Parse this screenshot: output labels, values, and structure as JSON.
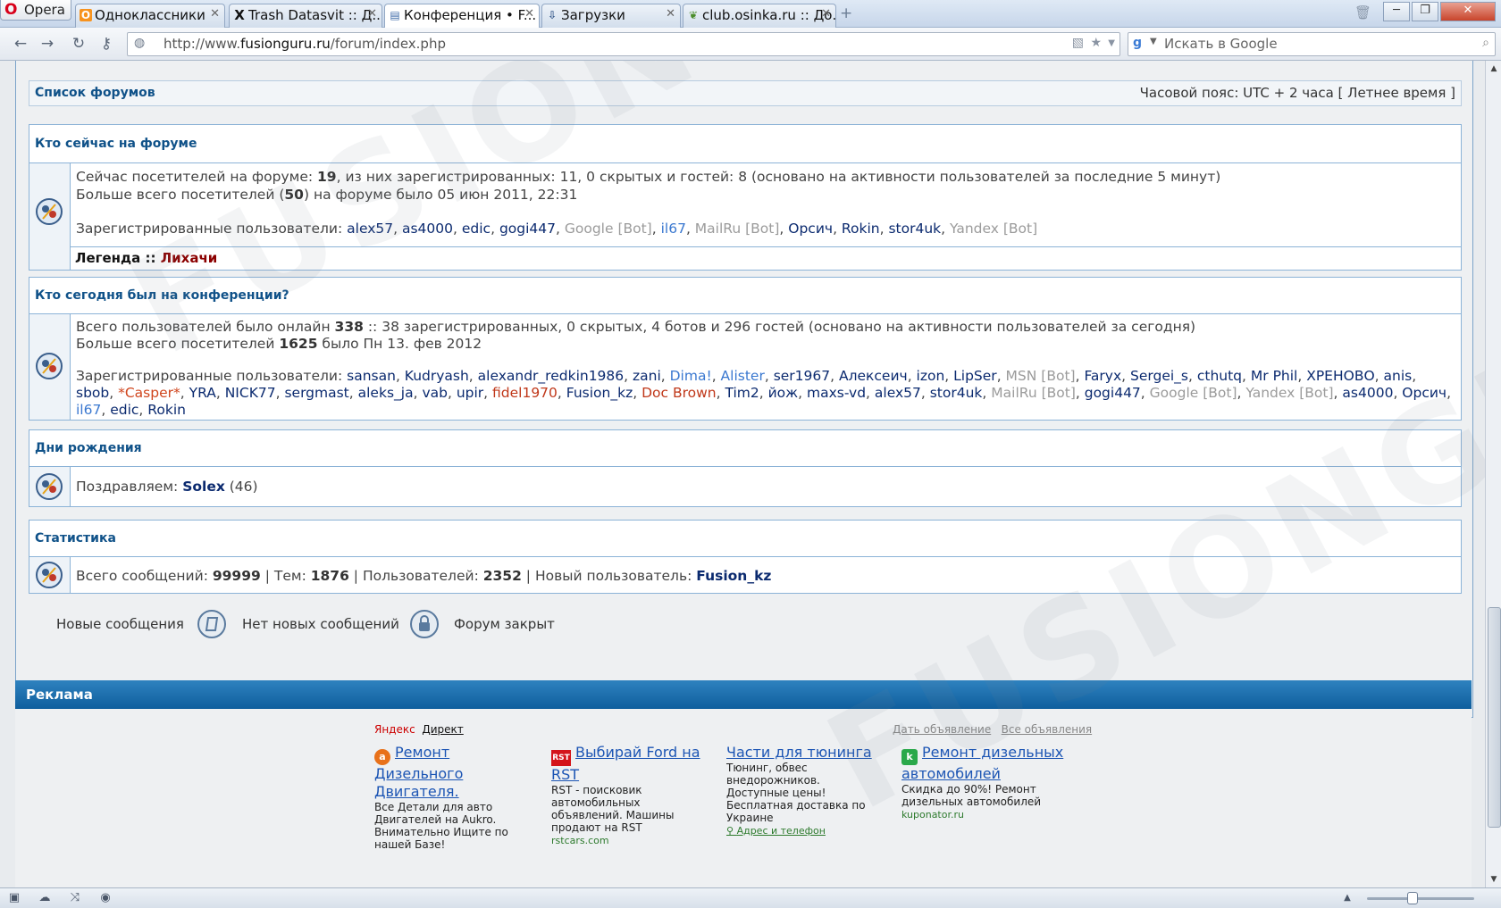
{
  "browser": {
    "menu_label": "Opera",
    "tabs": [
      {
        "label": "Одноклассники",
        "favicon": "ok-icon",
        "glyph": "О",
        "color": "#f7931e"
      },
      {
        "label": "Trash Datasvit :: Д...",
        "favicon": "x-icon",
        "glyph": "X",
        "color": "#111111"
      },
      {
        "label": "Конференция • F...",
        "favicon": "forum-icon",
        "glyph": "▤",
        "color": "#3c6aa8",
        "active": true
      },
      {
        "label": "Загрузки",
        "favicon": "download-icon",
        "glyph": "⇩",
        "color": "#3d5f8f"
      },
      {
        "label": "club.osinka.ru :: До...",
        "favicon": "leaf-icon",
        "glyph": "❦",
        "color": "#4a8d2a"
      }
    ],
    "url_prefix": "http://www.",
    "url_domain": "fusionguru.ru",
    "url_path": "/forum/index.php",
    "search_placeholder": "Искать в Google"
  },
  "forum": {
    "nav": {
      "index_link": "Список форумов",
      "timezone": "Часовой пояс: UTC + 2 часа [ Летнее время ]"
    },
    "online": {
      "title": "Кто сейчас на форуме",
      "l1_pre": "Сейчас посетителей на форуме: ",
      "l1_total": "19",
      "l1_post": ", из них зарегистрированных: 11, 0 скрытых и гостей: 8 (основано на активности пользователей за последние 5 минут)",
      "l2_pre": "Больше всего посетителей (",
      "l2_max": "50",
      "l2_post": ") на форуме было 05 июн 2011, 22:31",
      "reg_label": "Зарегистрированные пользователи: ",
      "users": [
        {
          "name": "alex57",
          "c": "u"
        },
        {
          "name": "as4000",
          "c": "u"
        },
        {
          "name": "edic",
          "c": "u"
        },
        {
          "name": "gogi447",
          "c": "u"
        },
        {
          "name": "Google [Bot]",
          "c": "ug"
        },
        {
          "name": "il67",
          "c": "ub"
        },
        {
          "name": "MailRu [Bot]",
          "c": "ug"
        },
        {
          "name": "Орсич",
          "c": "u"
        },
        {
          "name": "Rokin",
          "c": "u"
        },
        {
          "name": "stor4uk",
          "c": "u"
        },
        {
          "name": "Yandex [Bot]",
          "c": "ug"
        }
      ],
      "legend_label": "Легенда :: ",
      "legend_group": "Лихачи"
    },
    "today": {
      "title": "Кто сегодня был на конференции?",
      "l1_pre": "Всего пользователей было онлайн ",
      "l1_total": "338",
      "l1_post": " :: 38 зарегистрированных, 0 скрытых, 4 ботов и 296 гостей (основано на активности пользователей за сегодня)",
      "l2_pre": "Больше всего посетителей ",
      "l2_max": "1625",
      "l2_post": " было Пн 13. фев 2012",
      "reg_label": "Зарегистрированные пользователи: ",
      "users": [
        {
          "name": "sansan",
          "c": "u"
        },
        {
          "name": "Kudryash",
          "c": "u"
        },
        {
          "name": "alexandr_redkin1986",
          "c": "u"
        },
        {
          "name": "zani",
          "c": "u"
        },
        {
          "name": "Dima!",
          "c": "ub"
        },
        {
          "name": "Alister",
          "c": "ub"
        },
        {
          "name": "ser1967",
          "c": "u"
        },
        {
          "name": "Алексеич",
          "c": "u"
        },
        {
          "name": "izon",
          "c": "u"
        },
        {
          "name": "LipSer",
          "c": "u"
        },
        {
          "name": "MSN [Bot]",
          "c": "ug"
        },
        {
          "name": "Faryx",
          "c": "u"
        },
        {
          "name": "Sergei_s",
          "c": "u"
        },
        {
          "name": "cthutq",
          "c": "u"
        },
        {
          "name": "Mr Phil",
          "c": "u"
        },
        {
          "name": "ХРЕНОВО",
          "c": "u"
        },
        {
          "name": "anis",
          "c": "u"
        },
        {
          "name": "sbob",
          "c": "u"
        },
        {
          "name": "*Casper*",
          "c": "ur"
        },
        {
          "name": "YRA",
          "c": "u"
        },
        {
          "name": "NICK77",
          "c": "u"
        },
        {
          "name": "sergmast",
          "c": "u"
        },
        {
          "name": "aleks_ja",
          "c": "u"
        },
        {
          "name": "vab",
          "c": "u"
        },
        {
          "name": "upir",
          "c": "u"
        },
        {
          "name": "fidel1970",
          "c": "urd"
        },
        {
          "name": "Fusion_kz",
          "c": "u"
        },
        {
          "name": "Doc Brown",
          "c": "urd"
        },
        {
          "name": "Tim2",
          "c": "u"
        },
        {
          "name": "йож",
          "c": "u"
        },
        {
          "name": "maxs-vd",
          "c": "u"
        },
        {
          "name": "alex57",
          "c": "u"
        },
        {
          "name": "stor4uk",
          "c": "u"
        },
        {
          "name": "MailRu [Bot]",
          "c": "ug"
        },
        {
          "name": "gogi447",
          "c": "u"
        },
        {
          "name": "Google [Bot]",
          "c": "ug"
        },
        {
          "name": "Yandex [Bot]",
          "c": "ug"
        },
        {
          "name": "as4000",
          "c": "u"
        },
        {
          "name": "Орсич",
          "c": "u"
        },
        {
          "name": "il67",
          "c": "ub"
        },
        {
          "name": "edic",
          "c": "u"
        },
        {
          "name": "Rokin",
          "c": "u"
        }
      ]
    },
    "birthdays": {
      "title": "Дни рождения",
      "pre": "Поздравляем: ",
      "user": "Solex",
      "age": " (46)"
    },
    "stats": {
      "title": "Статистика",
      "posts_label": "Всего сообщений: ",
      "posts": "99999",
      "topics_label": " | Тем: ",
      "topics": "1876",
      "users_label": " | Пользователей: ",
      "users": "2352",
      "newest_label": " | Новый пользователь: ",
      "newest": "Fusion_kz"
    },
    "legend": {
      "new_posts": "Новые сообщения",
      "no_new_posts": "Нет новых сообщений",
      "locked": "Форум закрыт"
    }
  },
  "ads": {
    "header": "Реклама",
    "yandex": "Яндекс",
    "direct": "Директ",
    "give_ad": "Дать объявление",
    "all_ads": "Все объявления",
    "items": [
      {
        "title": "Ремонт Дизельного Двигателя.",
        "text": "Все Детали для авто Двигателей на Aukro. Внимательно Ищите по нашей Базе!",
        "src": "",
        "logo": "a",
        "logo_color": "#e8711a"
      },
      {
        "title": "Выбирай Ford на RST",
        "text": "RST - поисковик автомобильных объявлений. Машины продают на RST",
        "src": "rstcars.com",
        "logo": "RST",
        "logo_color": "#d4141a"
      },
      {
        "title": "Части для тюнинга",
        "text": "Тюнинг, обвес внедорожников. Доступные цены! Бесплатная доставка по Украине",
        "src": "Адрес и телефон",
        "logo": "",
        "logo_color": ""
      },
      {
        "title": "Ремонт дизельных автомобилей",
        "text": "Скидка до 90%! Ремонт дизельных автомобилей",
        "src": "kuponator.ru",
        "logo": "k",
        "logo_color": "#2aa84a"
      }
    ]
  },
  "watermark": "FUSIONGURU.RU"
}
